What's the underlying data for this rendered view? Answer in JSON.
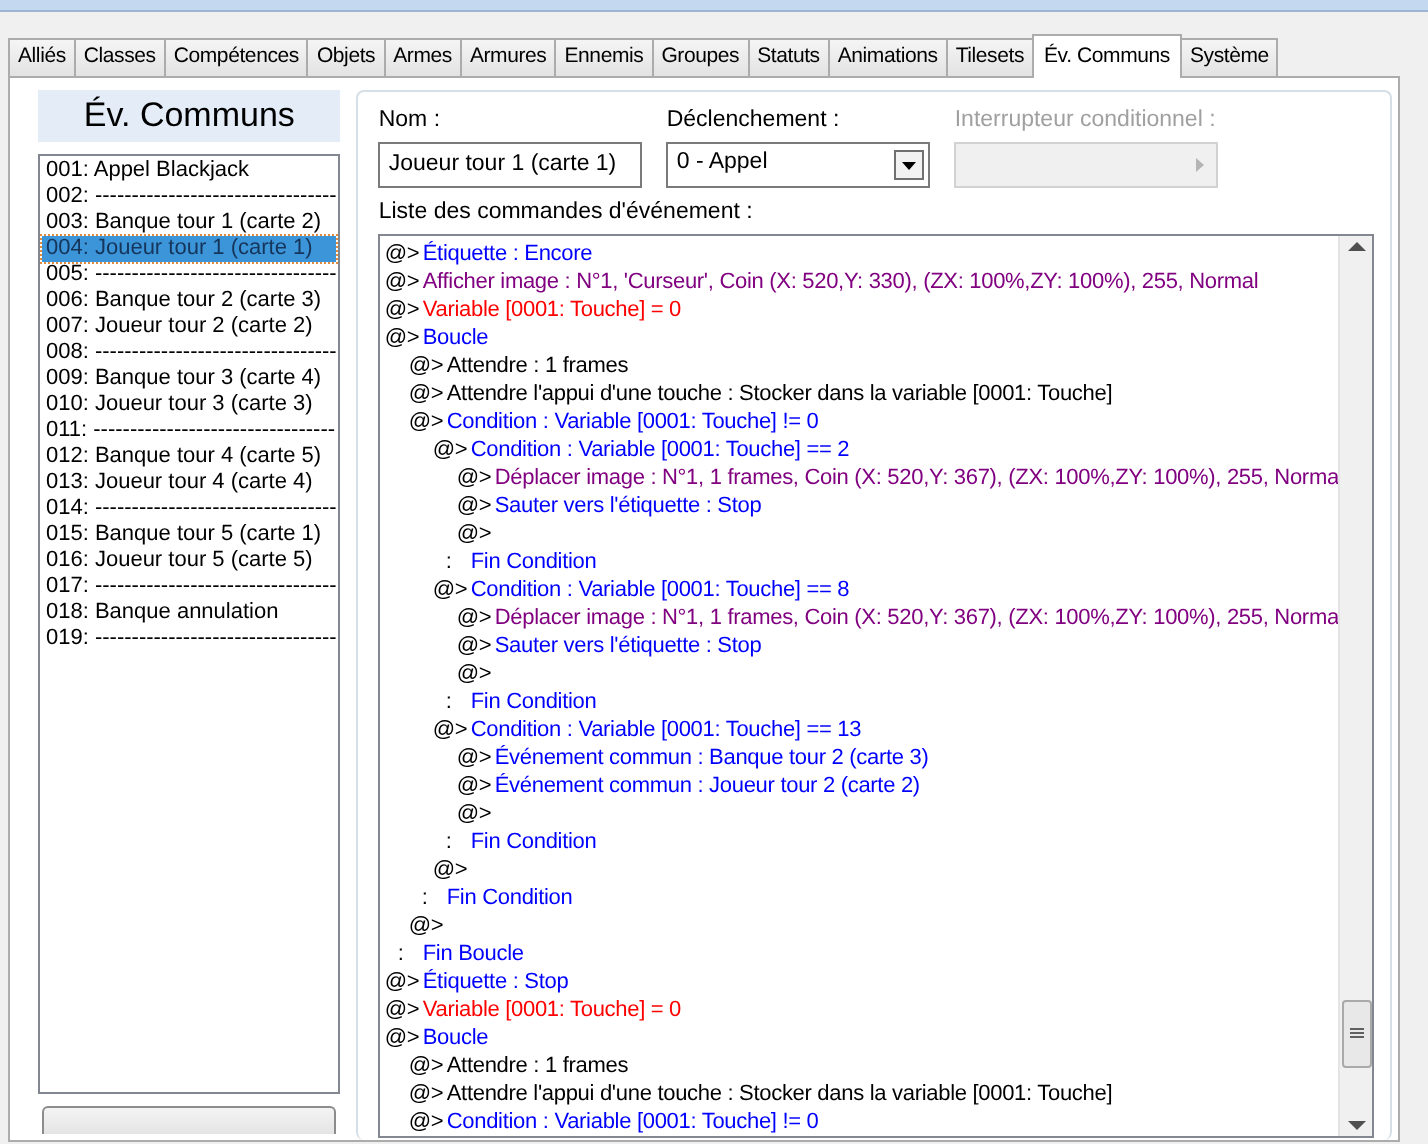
{
  "tabs": [
    {
      "label": "Alliés",
      "selected": false
    },
    {
      "label": "Classes",
      "selected": false
    },
    {
      "label": "Compétences",
      "selected": false
    },
    {
      "label": "Objets",
      "selected": false
    },
    {
      "label": "Armes",
      "selected": false
    },
    {
      "label": "Armures",
      "selected": false
    },
    {
      "label": "Ennemis",
      "selected": false
    },
    {
      "label": "Groupes",
      "selected": false
    },
    {
      "label": "Statuts",
      "selected": false
    },
    {
      "label": "Animations",
      "selected": false
    },
    {
      "label": "Tilesets",
      "selected": false
    },
    {
      "label": "Év. Communs",
      "selected": true
    },
    {
      "label": "Système",
      "selected": false
    }
  ],
  "sidebar": {
    "title": "Év. Communs",
    "items": [
      {
        "label": "001: Appel Blackjack",
        "selected": false
      },
      {
        "label": "002: ---------------------------------",
        "selected": false
      },
      {
        "label": "003: Banque tour 1 (carte 2)",
        "selected": false
      },
      {
        "label": "004: Joueur tour 1 (carte 1)",
        "selected": true
      },
      {
        "label": "005: ---------------------------------",
        "selected": false
      },
      {
        "label": "006: Banque tour 2 (carte 3)",
        "selected": false
      },
      {
        "label": "007: Joueur tour 2 (carte 2)",
        "selected": false
      },
      {
        "label": "008: ---------------------------------",
        "selected": false
      },
      {
        "label": "009: Banque tour 3 (carte 4)",
        "selected": false
      },
      {
        "label": "010: Joueur tour 3 (carte 3)",
        "selected": false
      },
      {
        "label": "011: ---------------------------------",
        "selected": false
      },
      {
        "label": "012: Banque tour 4 (carte 5)",
        "selected": false
      },
      {
        "label": "013: Joueur tour 4 (carte 4)",
        "selected": false
      },
      {
        "label": "014: ---------------------------------",
        "selected": false
      },
      {
        "label": "015: Banque tour 5 (carte 1)",
        "selected": false
      },
      {
        "label": "016: Joueur tour 5 (carte 5)",
        "selected": false
      },
      {
        "label": "017: ---------------------------------",
        "selected": false
      },
      {
        "label": "018: Banque annulation",
        "selected": false
      },
      {
        "label": "019: ---------------------------------",
        "selected": false
      }
    ]
  },
  "form": {
    "name": {
      "label": "Nom :",
      "value": "Joueur tour 1 (carte 1)"
    },
    "trigger": {
      "label": "Déclenchement :",
      "value": "0 - Appel"
    },
    "switch": {
      "label": "Interrupteur conditionnel :",
      "disabled": true
    },
    "commands_label": "Liste des commandes d'événement :"
  },
  "commands": [
    {
      "marker": "@>",
      "kind": "flow",
      "text": "Étiquette : Encore"
    },
    {
      "marker": "@>",
      "kind": "picture",
      "text": "Afficher image : N°1, 'Curseur', Coin (X: 520,Y: 330), (ZX: 100%,ZY: 100%), 255, Normal"
    },
    {
      "marker": "@>",
      "kind": "variable",
      "text": "Variable [0001: Touche] = 0"
    },
    {
      "marker": "@>",
      "kind": "flow",
      "text": "Boucle",
      "children": [
        {
          "marker": "@>",
          "kind": "plain",
          "text": "Attendre : 1 frames"
        },
        {
          "marker": "@>",
          "kind": "plain",
          "text": "Attendre l'appui d'une touche : Stocker dans la variable [0001: Touche]"
        },
        {
          "marker": "@>",
          "kind": "flow",
          "text": "Condition : Variable [0001: Touche] != 0",
          "children": [
            {
              "marker": "@>",
              "kind": "flow",
              "text": "Condition : Variable [0001: Touche] == 2",
              "children": [
                {
                  "marker": "@>",
                  "kind": "picture",
                  "text": "Déplacer image : N°1, 1 frames, Coin (X: 520,Y: 367), (ZX: 100%,ZY: 100%), 255, Norma"
                },
                {
                  "marker": "@>",
                  "kind": "flow",
                  "text": "Sauter vers l'étiquette : Stop"
                },
                {
                  "marker": "@>",
                  "kind": "plain"
                }
              ]
            },
            {
              "marker": ":",
              "kind": "flow",
              "text": "Fin Condition"
            },
            {
              "marker": "@>",
              "kind": "flow",
              "text": "Condition : Variable [0001: Touche] == 8",
              "children": [
                {
                  "marker": "@>",
                  "kind": "picture",
                  "text": "Déplacer image : N°1, 1 frames, Coin (X: 520,Y: 367), (ZX: 100%,ZY: 100%), 255, Norma"
                },
                {
                  "marker": "@>",
                  "kind": "flow",
                  "text": "Sauter vers l'étiquette : Stop"
                },
                {
                  "marker": "@>",
                  "kind": "plain"
                }
              ]
            },
            {
              "marker": ":",
              "kind": "flow",
              "text": "Fin Condition"
            },
            {
              "marker": "@>",
              "kind": "flow",
              "text": "Condition : Variable [0001: Touche] == 13",
              "children": [
                {
                  "marker": "@>",
                  "kind": "flow",
                  "text": "Événement commun : Banque tour 2 (carte 3)"
                },
                {
                  "marker": "@>",
                  "kind": "flow",
                  "text": "Événement commun : Joueur tour 2 (carte 2)"
                },
                {
                  "marker": "@>",
                  "kind": "plain"
                }
              ]
            },
            {
              "marker": ":",
              "kind": "flow",
              "text": "Fin Condition"
            },
            {
              "marker": "@>",
              "kind": "plain"
            }
          ]
        },
        {
          "marker": ":",
          "kind": "flow",
          "text": "Fin Condition"
        },
        {
          "marker": "@>",
          "kind": "plain"
        }
      ]
    },
    {
      "marker": ":",
      "kind": "flow",
      "text": "Fin Boucle"
    },
    {
      "marker": "@>",
      "kind": "flow",
      "text": "Étiquette : Stop"
    },
    {
      "marker": "@>",
      "kind": "variable",
      "text": "Variable [0001: Touche] = 0"
    },
    {
      "marker": "@>",
      "kind": "flow",
      "text": "Boucle",
      "children": [
        {
          "marker": "@>",
          "kind": "plain",
          "text": "Attendre : 1 frames"
        },
        {
          "marker": "@>",
          "kind": "plain",
          "text": "Attendre l'appui d'une touche : Stocker dans la variable [0001: Touche]"
        },
        {
          "marker": "@>",
          "kind": "flow",
          "text": "Condition : Variable [0001: Touche] != 0"
        }
      ]
    }
  ]
}
